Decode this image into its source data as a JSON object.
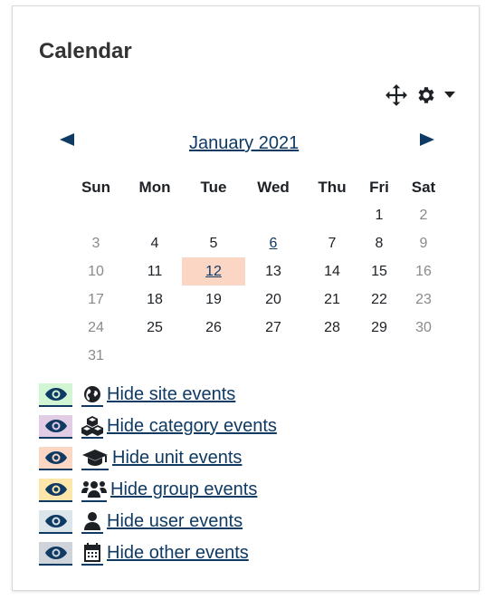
{
  "block": {
    "title": "Calendar",
    "controls": {
      "move_icon": "move-icon",
      "settings_icon": "gear-icon",
      "menu_icon": "caret-down-icon"
    }
  },
  "month_nav": {
    "prev_label": "◀",
    "next_label": "▶",
    "current_month": "January 2021"
  },
  "calendar": {
    "weekdays": [
      "Sun",
      "Mon",
      "Tue",
      "Wed",
      "Thu",
      "Fri",
      "Sat"
    ],
    "weeks": [
      [
        "",
        "",
        "",
        "",
        "",
        "1",
        "2"
      ],
      [
        "3",
        "4",
        "5",
        "6",
        "7",
        "8",
        "9"
      ],
      [
        "10",
        "11",
        "12",
        "13",
        "14",
        "15",
        "16"
      ],
      [
        "17",
        "18",
        "19",
        "20",
        "21",
        "22",
        "23"
      ],
      [
        "24",
        "25",
        "26",
        "27",
        "28",
        "29",
        "30"
      ],
      [
        "31",
        "",
        "",
        "",
        "",
        "",
        ""
      ]
    ],
    "linked_days": [
      "6",
      "12"
    ],
    "today": "12",
    "today_color": "#fbd6c4"
  },
  "filters": [
    {
      "label": "Hide site events",
      "icon": "globe-icon",
      "swatch_color": "#d2f5d3"
    },
    {
      "label": "Hide category events",
      "icon": "cubes-icon",
      "swatch_color": "#e1cde4"
    },
    {
      "label": "Hide unit events",
      "icon": "graduation-cap-icon",
      "swatch_color": "#fbd6c4"
    },
    {
      "label": "Hide group events",
      "icon": "users-icon",
      "swatch_color": "#fce6a9"
    },
    {
      "label": "Hide user events",
      "icon": "user-icon",
      "swatch_color": "#dce5ea"
    },
    {
      "label": "Hide other events",
      "icon": "calendar-icon",
      "swatch_color": "#ced4da"
    }
  ],
  "colors": {
    "link": "#0f3a63",
    "weekend_text": "#8a8a8a"
  }
}
